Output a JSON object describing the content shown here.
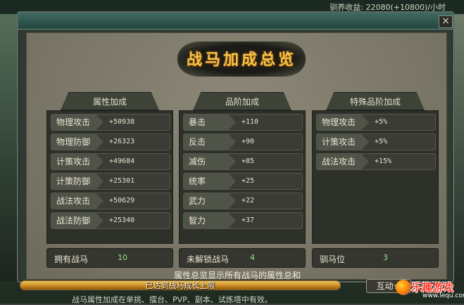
{
  "top_bar": {
    "income": "驯养收益: 22080(+10800)/小时"
  },
  "panel": {
    "title": "战马加成总览",
    "close_glyph": "×"
  },
  "columns": [
    {
      "header": "属性加成",
      "rows": [
        {
          "label": "物理攻击",
          "value": "+50938"
        },
        {
          "label": "物理防御",
          "value": "+26323"
        },
        {
          "label": "计策攻击",
          "value": "+49684"
        },
        {
          "label": "计策防御",
          "value": "+25301"
        },
        {
          "label": "战法攻击",
          "value": "+50629"
        },
        {
          "label": "战法防御",
          "value": "+25340"
        }
      ]
    },
    {
      "header": "品阶加成",
      "rows": [
        {
          "label": "暴击",
          "value": "+110"
        },
        {
          "label": "反击",
          "value": "+90"
        },
        {
          "label": "减伤",
          "value": "+85"
        },
        {
          "label": "统率",
          "value": "+25"
        },
        {
          "label": "武力",
          "value": "+22"
        },
        {
          "label": "智力",
          "value": "+37"
        }
      ]
    },
    {
      "header": "特殊品阶加成",
      "rows": [
        {
          "label": "物理攻击",
          "value": "+5%"
        },
        {
          "label": "计策攻击",
          "value": "+5%"
        },
        {
          "label": "战法攻击",
          "value": "+15%"
        }
      ]
    }
  ],
  "counters": [
    {
      "label": "拥有战马",
      "value": "10"
    },
    {
      "label": "未解锁战马",
      "value": "4"
    },
    {
      "label": "驯马位",
      "value": "3"
    }
  ],
  "note": "属性总览显示所有战马的属性总和",
  "progress": {
    "text": "已达到战马成长上限",
    "fraction": 1.0
  },
  "hint": "战马属性加成在单挑、擂台、PVP、副本、试炼塔中有效。",
  "interact_button": "互动★",
  "logo": {
    "name": "乐趣游戏",
    "url": "www.lequ.com"
  },
  "colors": {
    "title": "#f3c64a",
    "counter_value": "#9de08f",
    "progress": "#c7861e"
  }
}
